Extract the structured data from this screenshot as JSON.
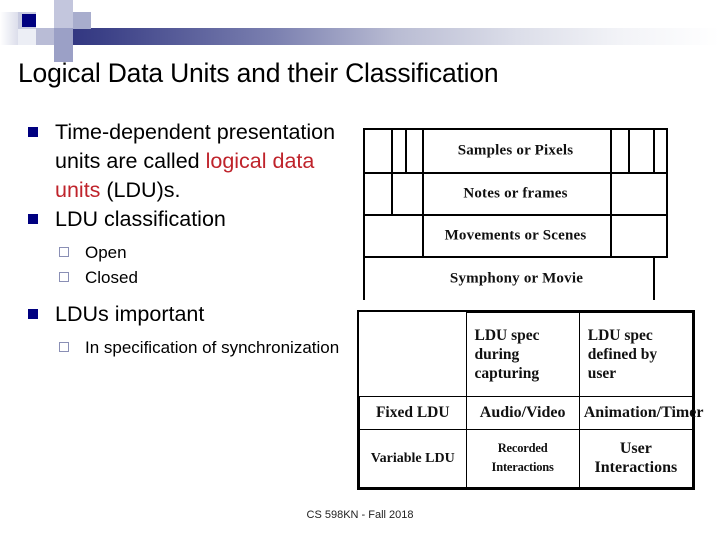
{
  "slide": {
    "title": "Logical Data Units and their Classification",
    "footer": "CS 598KN - Fall 2018"
  },
  "colors": {
    "bullet_navy": "#000080",
    "sub_bullet_border": "#8a8fb5",
    "emphasis_red": "#bf232b",
    "band_start": "#2b2f7d",
    "band_end": "#ffffff"
  },
  "content": {
    "bullet1": {
      "text_before": "Time-dependent presentation units are called ",
      "emphasis": "logical data units",
      "text_after": " (LDU)s."
    },
    "bullet2": {
      "text": "LDU classification",
      "sub": [
        {
          "text": "Open"
        },
        {
          "text": "Closed"
        }
      ]
    },
    "bullet3": {
      "text": "LDUs important",
      "sub": [
        {
          "text": "In specification of synchronization"
        }
      ]
    }
  },
  "figure_top": {
    "rows": [
      {
        "label": "Samples or Pixels",
        "nest": 4
      },
      {
        "label": "Notes or frames",
        "nest": 3
      },
      {
        "label": "Movements or Scenes",
        "nest": 2
      },
      {
        "label": "Symphony or Movie",
        "nest": 1
      }
    ]
  },
  "figure_bottom": {
    "header": [
      "",
      "LDU spec during capturing",
      "LDU spec defined by user"
    ],
    "rows": [
      {
        "label": "Fixed LDU",
        "cells": [
          "Audio/Video",
          "Animation/Timer"
        ]
      },
      {
        "label": "Variable LDU",
        "cells": [
          "Recorded Interactions",
          "User Interactions"
        ]
      }
    ]
  }
}
